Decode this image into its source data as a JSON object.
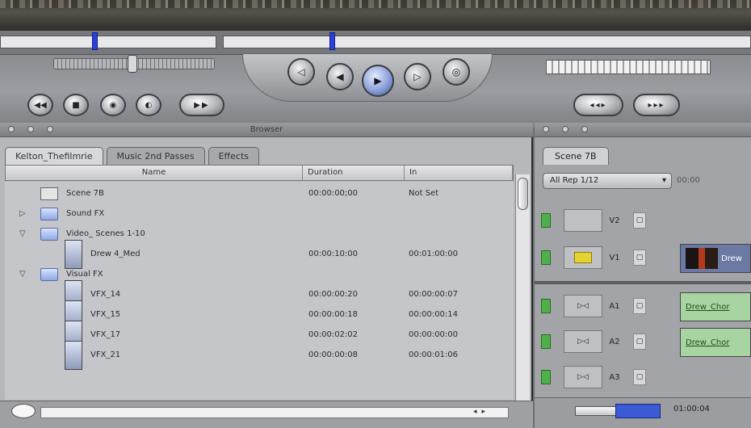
{
  "transport": {
    "buttons_center": [
      "◁",
      "◀",
      "▶",
      "▷",
      "◎"
    ],
    "buttons_left": [
      "◀◀",
      "■",
      "◉",
      "◐",
      "▶▶"
    ],
    "buttons_right": [
      "◂◂▸",
      "▸▸▸"
    ]
  },
  "browser": {
    "title": "Browser",
    "tabs": [
      "Kelton_Thefilmrie",
      "Music 2nd Passes",
      "Effects"
    ],
    "active_tab": 0,
    "columns": [
      "Name",
      "Duration",
      "In"
    ],
    "rows": [
      {
        "name": "Scene 7B",
        "type": "sequence",
        "indent": 0,
        "twisty": "",
        "duration": "00:00:00;00",
        "in": "Not Set"
      },
      {
        "name": "Sound FX",
        "type": "folder",
        "indent": 0,
        "twisty": "▷",
        "duration": "",
        "in": ""
      },
      {
        "name": "Video_ Scenes 1-10",
        "type": "folder",
        "indent": 0,
        "twisty": "▽",
        "duration": "",
        "in": ""
      },
      {
        "name": "Drew 4_Med",
        "type": "clip",
        "indent": 1,
        "twisty": "",
        "duration": "00:00:10:00",
        "in": "00:01:00:00"
      },
      {
        "name": "Visual FX",
        "type": "folder",
        "indent": 0,
        "twisty": "▽",
        "duration": "",
        "in": ""
      },
      {
        "name": "VFX_14",
        "type": "clip",
        "indent": 1,
        "twisty": "",
        "duration": "00:00:00:20",
        "in": "00:00:00:07"
      },
      {
        "name": "VFX_15",
        "type": "clip",
        "indent": 1,
        "twisty": "",
        "duration": "00:00:00:18",
        "in": "00:00:00:14"
      },
      {
        "name": "VFX_17",
        "type": "clip",
        "indent": 1,
        "twisty": "",
        "duration": "00:00:02:02",
        "in": "00:00:00:00"
      },
      {
        "name": "VFX_21",
        "type": "clip",
        "indent": 1,
        "twisty": "",
        "duration": "00:00:00:08",
        "in": "00:00:01:06"
      }
    ]
  },
  "timeline": {
    "tab": "Scene 7B",
    "sequence_select": "All Rep 1/12",
    "timecode_top": "00:00",
    "video_tracks": [
      {
        "name": "V2",
        "clip": ""
      },
      {
        "name": "V1",
        "clip": "Drew"
      }
    ],
    "audio_tracks": [
      {
        "name": "A1",
        "clip": "Drew_Chor"
      },
      {
        "name": "A2",
        "clip": "Drew_Chor"
      },
      {
        "name": "A3",
        "clip": ""
      }
    ],
    "bottom_timecode": "01:00:04"
  },
  "colors": {
    "marker": "#2c3fd8",
    "track_green": "#4fb04a",
    "audio_clip": "#a8d4a2"
  }
}
